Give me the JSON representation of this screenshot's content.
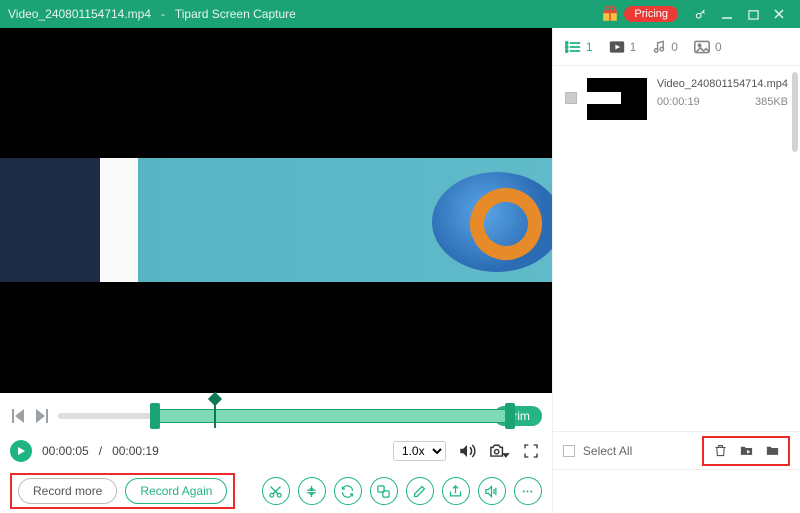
{
  "titlebar": {
    "filename": "Video_240801154714.mp4",
    "separator": "-",
    "app_name": "Tipard Screen Capture",
    "pricing_label": "Pricing"
  },
  "playback": {
    "current": "00:00:05",
    "sep": "/ ",
    "total": "00:00:19",
    "speed": "1.0x"
  },
  "timeline": {
    "trim_label": "Trim"
  },
  "footer": {
    "record_more": "Record more",
    "record_again": "Record Again"
  },
  "tabs": {
    "list_count": "1",
    "video_count": "1",
    "audio_count": "0",
    "image_count": "0"
  },
  "item": {
    "name": "Video_240801154714.mp4",
    "duration": "00:00:19",
    "size": "385KB"
  },
  "right_bottom": {
    "select_all": "Select All"
  }
}
